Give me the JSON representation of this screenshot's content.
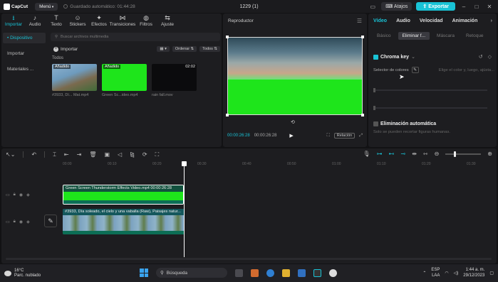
{
  "titlebar": {
    "logo": "CapCut",
    "menu": "Menú",
    "autosave": "Guardado automático: 01:44:28",
    "project": "1229 (1)",
    "shortcuts": "Atajos",
    "export": "Exportar"
  },
  "tools": [
    {
      "icon": "import-icon",
      "label": "Importar",
      "glyph": "⭳"
    },
    {
      "icon": "audio-icon",
      "label": "Audio",
      "glyph": "♪"
    },
    {
      "icon": "text-icon",
      "label": "Texto",
      "glyph": "T"
    },
    {
      "icon": "stickers-icon",
      "label": "Stickers",
      "glyph": "☺"
    },
    {
      "icon": "effects-icon",
      "label": "Efectos",
      "glyph": "✦"
    },
    {
      "icon": "transitions-icon",
      "label": "Transiciones",
      "glyph": "⋈"
    },
    {
      "icon": "filters-icon",
      "label": "Filtros",
      "glyph": "◍"
    },
    {
      "icon": "adjust-icon",
      "label": "Ajuste",
      "glyph": "⇆"
    }
  ],
  "sidenav": {
    "device": "• Dispositivo",
    "import": "Importar",
    "library": "Materiales ..."
  },
  "media": {
    "search_placeholder": "Buscar archivos multimedia",
    "import_label": "Importar",
    "sort": "Ordenar",
    "all": "Todos",
    "section": "Todos",
    "clips": [
      {
        "tag": "Añadido",
        "duration": "",
        "name": "#3933, Dí... Mat.mp4"
      },
      {
        "tag": "Añadido",
        "duration": "",
        "name": "Green Sc...ideo.mp4"
      },
      {
        "tag": "",
        "duration": "02:02",
        "name": "rain fall.mov"
      }
    ]
  },
  "player": {
    "title": "Reproductor",
    "current_time": "00:00:26:28",
    "total_time": "00:00:26:28",
    "ratio": "Relación"
  },
  "inspector": {
    "tabs": [
      "Vídeo",
      "Audio",
      "Velocidad",
      "Animación"
    ],
    "subtabs": [
      "Básico",
      "Eliminar f...",
      "Máscara",
      "Retoque"
    ],
    "chroma_key": "Chroma key",
    "color_selector": "Selector de colores",
    "color_hint": "Elige el color y, luego, ajústa...",
    "auto_removal": "Eliminación automática",
    "auto_hint": "Solo se pueden recortar figuras humanas."
  },
  "timeline": {
    "ruler": [
      "00:00",
      "00:10",
      "00:20",
      "00:30",
      "00:40",
      "00:50",
      "01:00",
      "01:10",
      "01:20",
      "01:30"
    ],
    "clip_top": "Green Screen Thunderstorm Effects Video.mp4   00:00:26:28",
    "clip_main": "#3933, Día soleado, el cielo y una vaballa (Raw), Paisajes natur..."
  },
  "taskbar": {
    "temp": "16°C",
    "weather": "Parc. nublado",
    "search": "Búsqueda",
    "lang1": "ESP",
    "lang2": "LAA",
    "time": "1:44 a. m.",
    "date": "29/12/2023"
  },
  "colors": {
    "accent": "#19c3d6",
    "green_screen": "#1ee51b"
  }
}
